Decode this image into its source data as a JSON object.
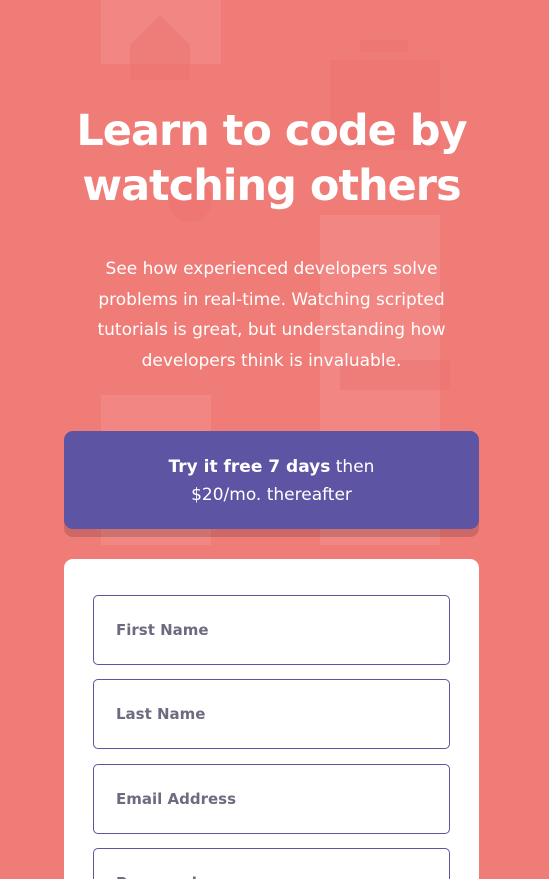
{
  "hero": {
    "title": "Learn to code by watching others",
    "description": "See how experienced developers solve problems in real-time. Watching scripted tutorials is great, but understanding how developers think is invaluable."
  },
  "promo": {
    "bold": "Try it free 7 days",
    "rest": " then",
    "line2": "$20/mo. thereafter"
  },
  "form": {
    "first_name_placeholder": "First Name",
    "last_name_placeholder": "Last Name",
    "email_placeholder": "Email Address",
    "password_placeholder": "Password"
  },
  "colors": {
    "background": "#f07c78",
    "accent": "#5e54a4",
    "card": "#ffffff"
  }
}
